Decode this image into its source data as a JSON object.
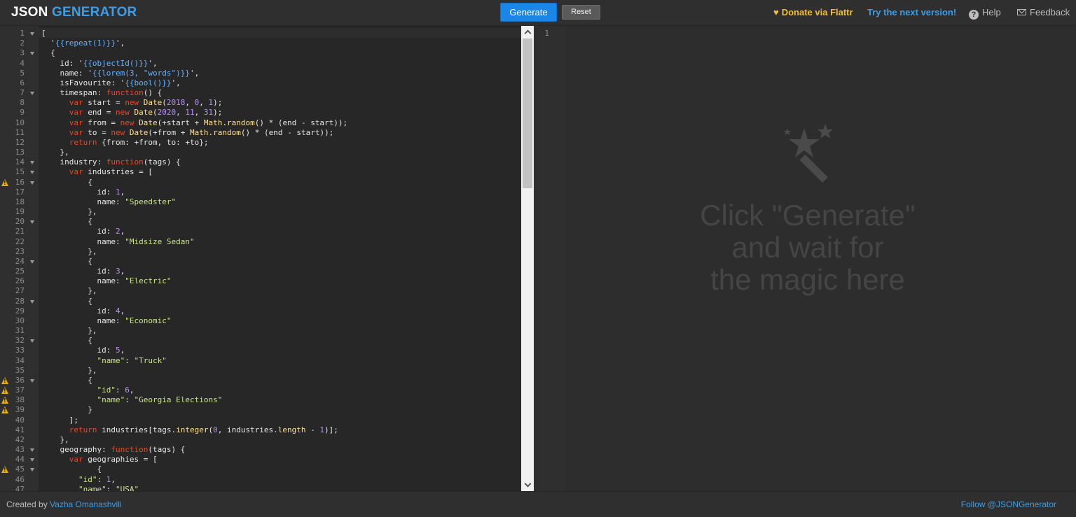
{
  "header": {
    "logo_part1": "JSON",
    "logo_part2": "GENERATOR",
    "generate_label": "Generate",
    "reset_label": "Reset",
    "donate_label": "Donate via Flattr",
    "next_label": "Try the next version!",
    "help_label": "Help",
    "feedback_label": "Feedback"
  },
  "editor": {
    "warning_lines": [
      16,
      36,
      37,
      38,
      39,
      45
    ],
    "fold_lines": [
      1,
      3,
      7,
      14,
      15,
      16,
      20,
      24,
      28,
      32,
      36,
      43,
      44,
      45
    ],
    "lines": [
      "[",
      "  '{{repeat(1)}}',",
      "  {",
      "    id: '{{objectId()}}',",
      "    name: '{{lorem(3, \"words\")}}',",
      "    isFavourite: '{{bool()}}',",
      "    timespan: function() {",
      "      var start = new Date(2018, 0, 1);",
      "      var end = new Date(2020, 11, 31);",
      "      var from = new Date(+start + Math.random() * (end - start));",
      "      var to = new Date(+from + Math.random() * (end - start));",
      "      return {from: +from, to: +to};",
      "    },",
      "    industry: function(tags) {",
      "      var industries = [",
      "          {",
      "            id: 1,",
      "            name: \"Speedster\"",
      "          },",
      "          {",
      "            id: 2,",
      "            name: \"Midsize Sedan\"",
      "          },",
      "          {",
      "            id: 3,",
      "            name: \"Electric\"",
      "          },",
      "          {",
      "            id: 4,",
      "            name: \"Economic\"",
      "          },",
      "          {",
      "            id: 5,",
      "            \"name\": \"Truck\"",
      "          },",
      "          {",
      "            \"id\": 6,",
      "            \"name\": \"Georgia Elections\"",
      "          }",
      "      ];",
      "      return industries[tags.integer(0, industries.length - 1)];",
      "    },",
      "    geography: function(tags) {",
      "      var geographies = [",
      "            {",
      "        \"id\": 1,",
      "        \"name\": \"USA\""
    ]
  },
  "output": {
    "line_number": "1",
    "placeholder_line1": "Click \"Generate\"",
    "placeholder_line2": "and wait for",
    "placeholder_line3": "the magic here"
  },
  "footer": {
    "created_by": "Created by",
    "author": "Vazha Omanashvili",
    "follow": "Follow @JSONGenerator"
  },
  "colors": {
    "accent": "#1a86e8",
    "link": "#3d9ee8",
    "donate": "#f0c030",
    "warning": "#e8b000"
  },
  "icons": {
    "donate": "heart-icon",
    "help": "question-circle-icon",
    "feedback": "envelope-icon",
    "output": "magic-wand-icon"
  }
}
